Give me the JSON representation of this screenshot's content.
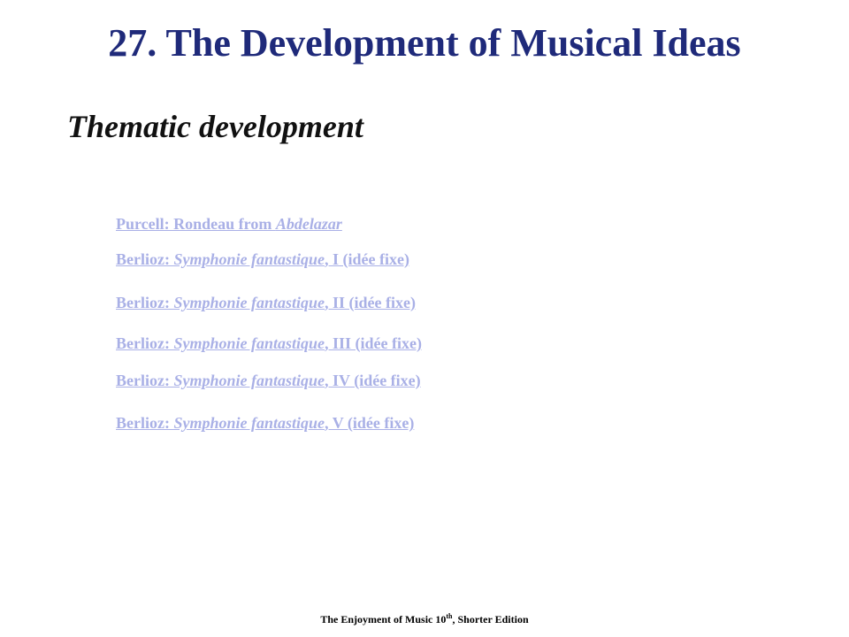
{
  "slide": {
    "title": "27. The Development of Musical Ideas",
    "subtitle": "Thematic development"
  },
  "links": [
    {
      "prefix": "Purcell: Rondeau from ",
      "work": "Abdelazar",
      "suffix": ""
    },
    {
      "prefix": "Berlioz: ",
      "work": "Symphonie fantastique",
      "suffix": ", I (idée fixe)"
    },
    {
      "prefix": "Berlioz: ",
      "work": "Symphonie fantastique",
      "suffix": ", II (idée fixe)"
    },
    {
      "prefix": "Berlioz: ",
      "work": "Symphonie fantastique",
      "suffix": ", III (idée fixe)"
    },
    {
      "prefix": "Berlioz: ",
      "work": "Symphonie fantastique",
      "suffix": ", IV (idée fixe)"
    },
    {
      "prefix": "Berlioz: ",
      "work": "Symphonie fantastique",
      "suffix": ", V (idée fixe)"
    }
  ],
  "footer": {
    "text_before": "The Enjoyment of Music 10",
    "superscript": "th",
    "text_after": ", Shorter Edition"
  },
  "colors": {
    "title": "#1f2a7a",
    "link": "#a9b0e6"
  }
}
